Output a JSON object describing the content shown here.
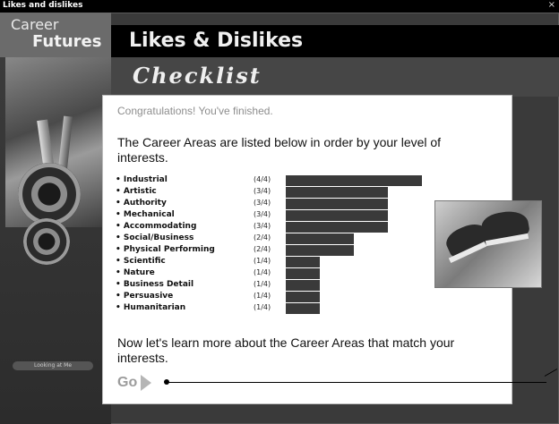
{
  "window": {
    "title": "Likes and dislikes",
    "close_glyph": "×"
  },
  "logo": {
    "line1": "Career",
    "line2": "Futures"
  },
  "header": {
    "title": "Likes & Dislikes",
    "subtitle": "Checklist"
  },
  "side": {
    "label": "Looking at Me"
  },
  "main": {
    "congrats": "Congratulations! You've finished.",
    "intro": "The Career Areas are listed below in order by your level of interests.",
    "outro": "Now let's learn more about the Career Areas that match your interests.",
    "go_label": "Go"
  },
  "chart_data": {
    "type": "bar",
    "categories": [
      "Industrial",
      "Artistic",
      "Authority",
      "Mechanical",
      "Accommodating",
      "Social/Business",
      "Physical Performing",
      "Scientific",
      "Nature",
      "Business Detail",
      "Persuasive",
      "Humanitarian"
    ],
    "scores": [
      "(4/4)",
      "(3/4)",
      "(3/4)",
      "(3/4)",
      "(3/4)",
      "(2/4)",
      "(2/4)",
      "(1/4)",
      "(1/4)",
      "(1/4)",
      "(1/4)",
      "(1/4)"
    ],
    "values": [
      4,
      3,
      3,
      3,
      3,
      2,
      2,
      1,
      1,
      1,
      1,
      1
    ],
    "ylim": [
      0,
      4
    ]
  },
  "colors": {
    "bar": "#3a3a3a",
    "header_bg": "#000000",
    "go_text": "#9c9c9c"
  },
  "icons": {
    "go_arrow": "arrow-right-icon"
  }
}
